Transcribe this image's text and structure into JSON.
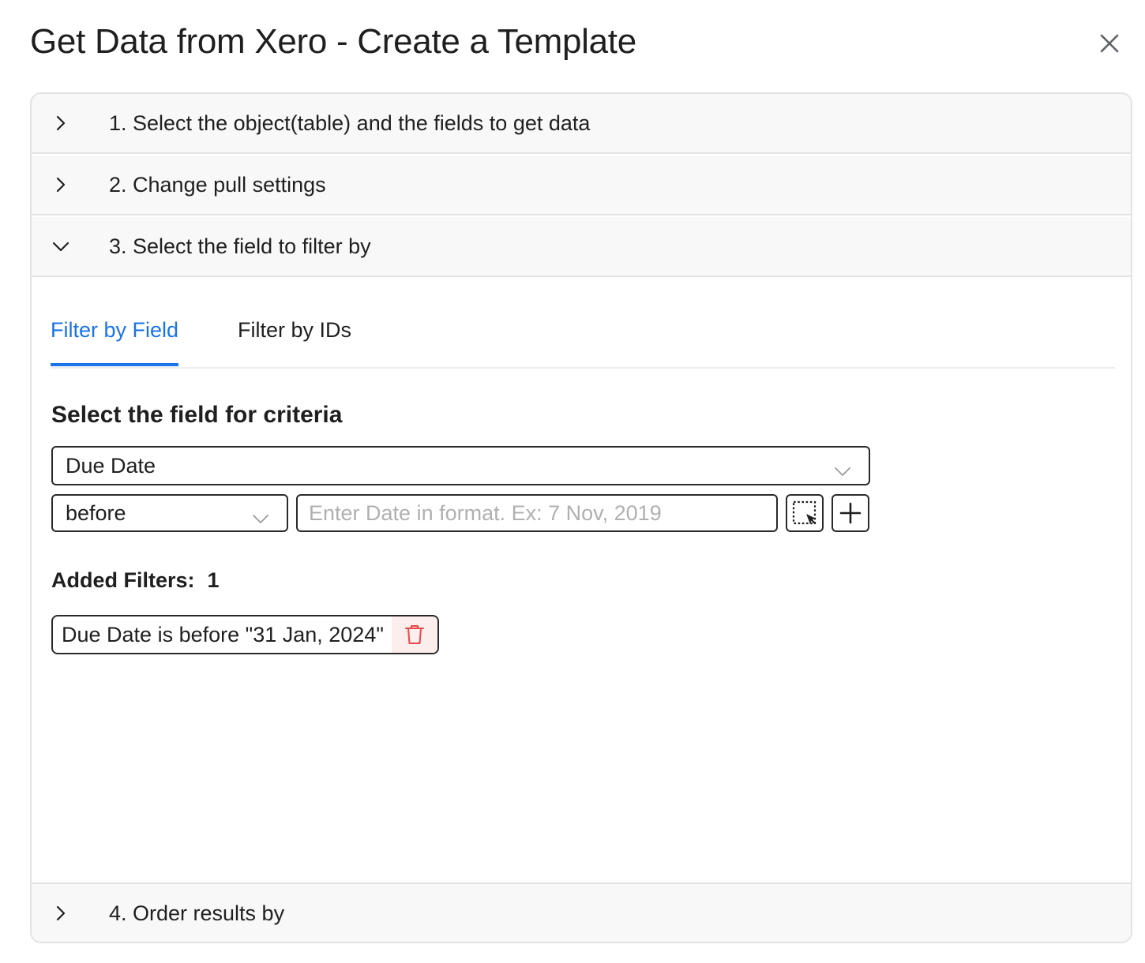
{
  "dialog": {
    "title": "Get Data from Xero - Create a Template"
  },
  "accordion": {
    "sections": [
      {
        "label": "1. Select the object(table) and the fields to get data",
        "expanded": false
      },
      {
        "label": "2. Change pull settings",
        "expanded": false
      },
      {
        "label": "3. Select the field to filter by",
        "expanded": true
      },
      {
        "label": "4. Order results by",
        "expanded": false
      }
    ]
  },
  "filter_panel": {
    "tabs": [
      {
        "label": "Filter by Field",
        "active": true
      },
      {
        "label": "Filter by IDs",
        "active": false
      }
    ],
    "section_title": "Select the field for criteria",
    "field_select": {
      "value": "Due Date"
    },
    "operator_select": {
      "value": "before"
    },
    "date_input": {
      "value": "",
      "placeholder": "Enter Date in format. Ex: 7 Nov, 2019"
    },
    "added_filters": {
      "label": "Added Filters:",
      "count": "1",
      "items": [
        {
          "text": "Due Date is before \"31 Jan, 2024\""
        }
      ]
    }
  },
  "colors": {
    "accent": "#1a73e8",
    "delete_icon": "#e5484d",
    "delete_bg": "#fdeeee",
    "header_bg": "#f8f8f8",
    "border": "#e3e3e3"
  },
  "icons": {
    "close": "close-icon",
    "collapsed": "chevron-right-icon",
    "expanded": "chevron-down-icon",
    "dropdown": "chevron-down-icon",
    "select_range": "select-range-icon",
    "add": "plus-icon",
    "delete": "trash-icon"
  }
}
